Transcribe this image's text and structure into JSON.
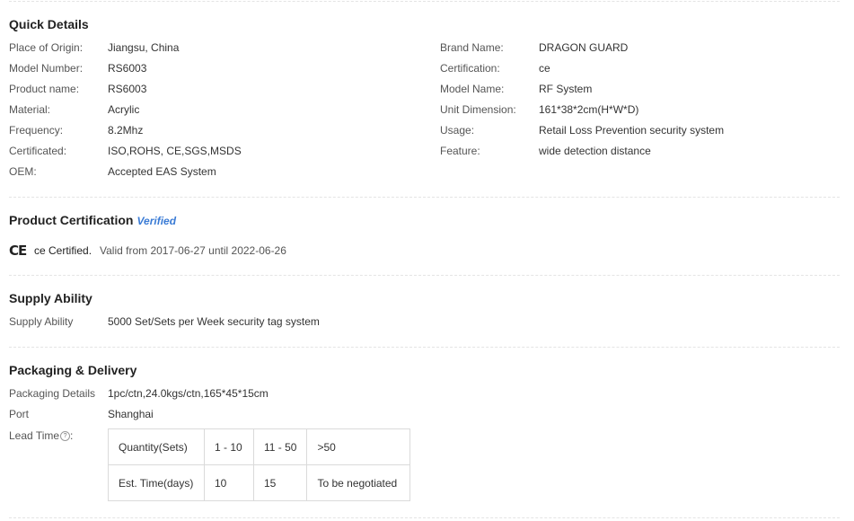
{
  "quick_details": {
    "title": "Quick Details",
    "left": [
      {
        "label": "Place of Origin:",
        "value": "Jiangsu, China"
      },
      {
        "label": "Model Number:",
        "value": "RS6003"
      },
      {
        "label": "Product name:",
        "value": "RS6003"
      },
      {
        "label": "Material:",
        "value": "Acrylic"
      },
      {
        "label": "Frequency:",
        "value": "8.2Mhz"
      },
      {
        "label": "Certificated:",
        "value": "ISO,ROHS, CE,SGS,MSDS"
      },
      {
        "label": "OEM:",
        "value": "Accepted EAS System"
      }
    ],
    "right": [
      {
        "label": "Brand Name:",
        "value": "DRAGON GUARD"
      },
      {
        "label": "Certification:",
        "value": "ce"
      },
      {
        "label": "Model Name:",
        "value": "RF System"
      },
      {
        "label": "Unit Dimension:",
        "value": "161*38*2cm(H*W*D)"
      },
      {
        "label": "Usage:",
        "value": "Retail Loss Prevention security system"
      },
      {
        "label": "Feature:",
        "value": "wide detection distance"
      }
    ]
  },
  "product_certification": {
    "title": "Product Certification",
    "verified": "Verified",
    "icon": "ce-mark-icon",
    "ce_symbol": "CE",
    "cert_name": "ce Certified.",
    "validity": "Valid from 2017-06-27 until 2022-06-26"
  },
  "supply_ability": {
    "title": "Supply Ability",
    "label": "Supply Ability",
    "value": "5000 Set/Sets per Week security tag system"
  },
  "packaging": {
    "title": "Packaging & Delivery",
    "rows": [
      {
        "label": "Packaging Details",
        "value": "1pc/ctn,24.0kgs/ctn,165*45*15cm"
      },
      {
        "label": "Port",
        "value": "Shanghai"
      }
    ],
    "lead_time_label": "Lead Time",
    "help_icon": "question-circle-icon",
    "help_glyph": "?",
    "lead_time_label_suffix": ":",
    "lead_table": {
      "headers": [
        "Quantity(Sets)",
        "1 - 10",
        "11 - 50",
        ">50"
      ],
      "row": [
        "Est. Time(days)",
        "10",
        "15",
        "To be negotiated"
      ]
    }
  }
}
